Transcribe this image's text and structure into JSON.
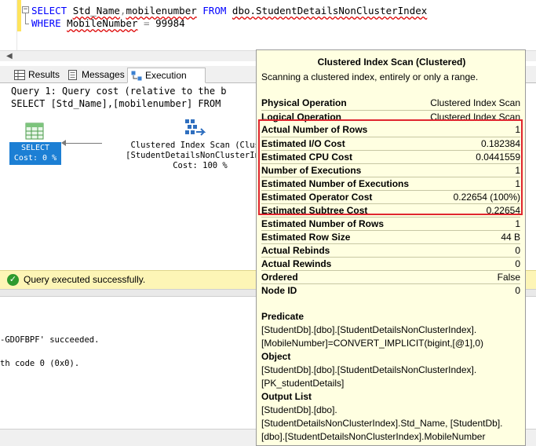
{
  "editor": {
    "line1": {
      "kw1": "SELECT",
      "col": "Std_Name",
      "sep": ",",
      "col2": "mobilenumber",
      "kw2": "FROM",
      "table": "dbo.StudentDetailsNonClusterIndex"
    },
    "line2": {
      "kw": "WHERE",
      "col": "MobileNumber",
      "op": "=",
      "val": "99984"
    },
    "collapse_glyph": "−"
  },
  "tabs": [
    {
      "label": "Results",
      "icon": "grid-icon"
    },
    {
      "label": "Messages",
      "icon": "messages-icon"
    },
    {
      "label": "Execution plan",
      "icon": "execution-plan-icon",
      "active": true
    }
  ],
  "plan": {
    "query_line": "Query 1: Query cost (relative to the b",
    "select_line": "SELECT [Std_Name],[mobilenumber] FROM",
    "select_node": {
      "label": "SELECT",
      "cost": "Cost: 0 %"
    },
    "scan_node": {
      "line1": "Clustered Index Scan (Cluste",
      "line2": "[StudentDetailsNonClusterIndex",
      "cost": "Cost: 100 %"
    }
  },
  "status": {
    "text": "Query executed successfully."
  },
  "messages": {
    "line1": "-GDOFBPF' succeeded.",
    "line2": "th code 0 (0x0)."
  },
  "tooltip": {
    "title": "Clustered Index Scan (Clustered)",
    "description": "Scanning a clustered index, entirely or only a range.",
    "rows": [
      {
        "label": "Physical Operation",
        "value": "Clustered Index Scan"
      },
      {
        "label": "Logical Operation",
        "value": "Clustered Index Scan"
      },
      {
        "label": "Actual Number of Rows",
        "value": "1"
      },
      {
        "label": "Estimated I/O Cost",
        "value": "0.182384"
      },
      {
        "label": "Estimated CPU Cost",
        "value": "0.0441559"
      },
      {
        "label": "Number of Executions",
        "value": "1"
      },
      {
        "label": "Estimated Number of Executions",
        "value": "1"
      },
      {
        "label": "Estimated Operator Cost",
        "value": "0.22654 (100%)"
      },
      {
        "label": "Estimated Subtree Cost",
        "value": "0.22654"
      },
      {
        "label": "Estimated Number of Rows",
        "value": "1"
      },
      {
        "label": "Estimated Row Size",
        "value": "44 B"
      },
      {
        "label": "Actual Rebinds",
        "value": "0"
      },
      {
        "label": "Actual Rewinds",
        "value": "0"
      },
      {
        "label": "Ordered",
        "value": "False"
      },
      {
        "label": "Node ID",
        "value": "0"
      }
    ],
    "predicate": {
      "heading": "Predicate",
      "lines": [
        "[StudentDb].[dbo].[StudentDetailsNonClusterIndex].",
        "[MobileNumber]=CONVERT_IMPLICIT(bigint,[@1],0)"
      ]
    },
    "object": {
      "heading": "Object",
      "lines": [
        "[StudentDb].[dbo].[StudentDetailsNonClusterIndex].",
        "[PK_studentDetails]"
      ]
    },
    "output_list": {
      "heading": "Output List",
      "lines": [
        "[StudentDb].[dbo].",
        "[StudentDetailsNonClusterIndex].Std_Name, [StudentDb].",
        "[dbo].[StudentDetailsNonClusterIndex].MobileNumber"
      ]
    }
  },
  "colors": {
    "keyword": "#0000ff",
    "select_node_bg": "#1c7fd4",
    "status_bg": "#fdf5b6",
    "tooltip_bg": "#ffffe1",
    "highlight_border": "#e0262f"
  }
}
